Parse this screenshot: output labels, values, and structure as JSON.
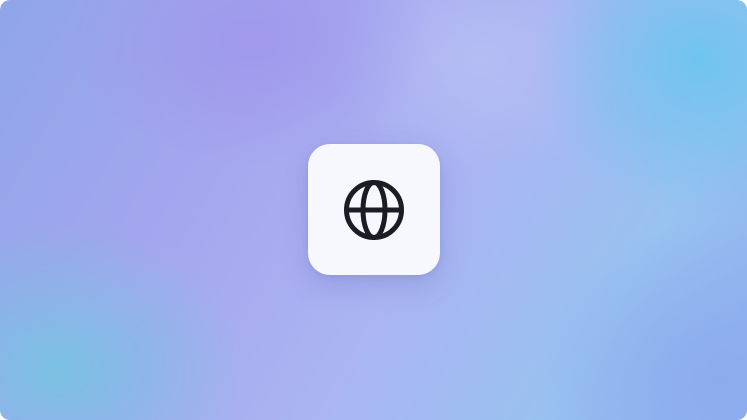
{
  "background": {
    "colors": [
      "#a4a6ee",
      "#abb4f2",
      "#6ec4f0",
      "#76c4e2",
      "#8fb0ee"
    ]
  },
  "app_tile": {
    "icon": "globe-icon",
    "tile_color": "#f7f8fd",
    "icon_color": "#1c1c24"
  }
}
